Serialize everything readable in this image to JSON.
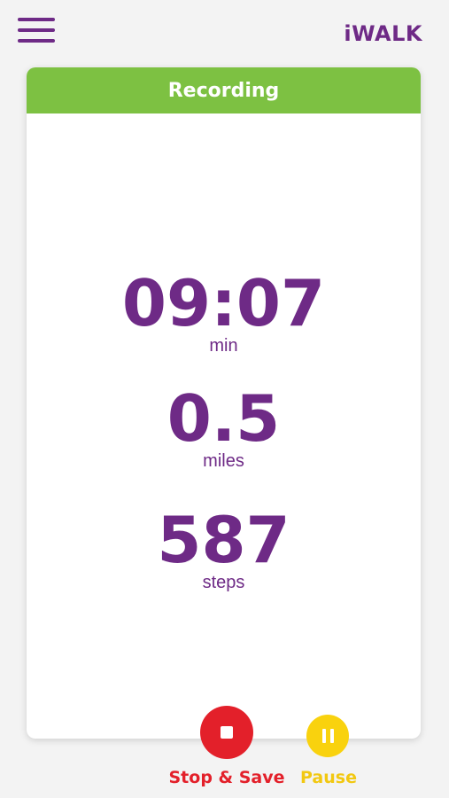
{
  "header": {
    "menu_icon": "hamburger-menu-icon",
    "logo_text": "iWALK"
  },
  "card": {
    "title": "Recording",
    "header_color": "#7dc142"
  },
  "stats": {
    "time": {
      "value": "09:07",
      "unit": "min"
    },
    "distance": {
      "value": "0.5",
      "unit": "miles"
    },
    "steps": {
      "value": "587",
      "unit": "steps"
    }
  },
  "controls": {
    "stop": {
      "label": "Stop & Save",
      "icon": "stop-icon",
      "color": "#e3202a"
    },
    "pause": {
      "label": "Pause",
      "icon": "pause-icon",
      "color": "#f9d20e"
    }
  },
  "colors": {
    "brand": "#6e2a86",
    "background": "#f3f3f3"
  }
}
